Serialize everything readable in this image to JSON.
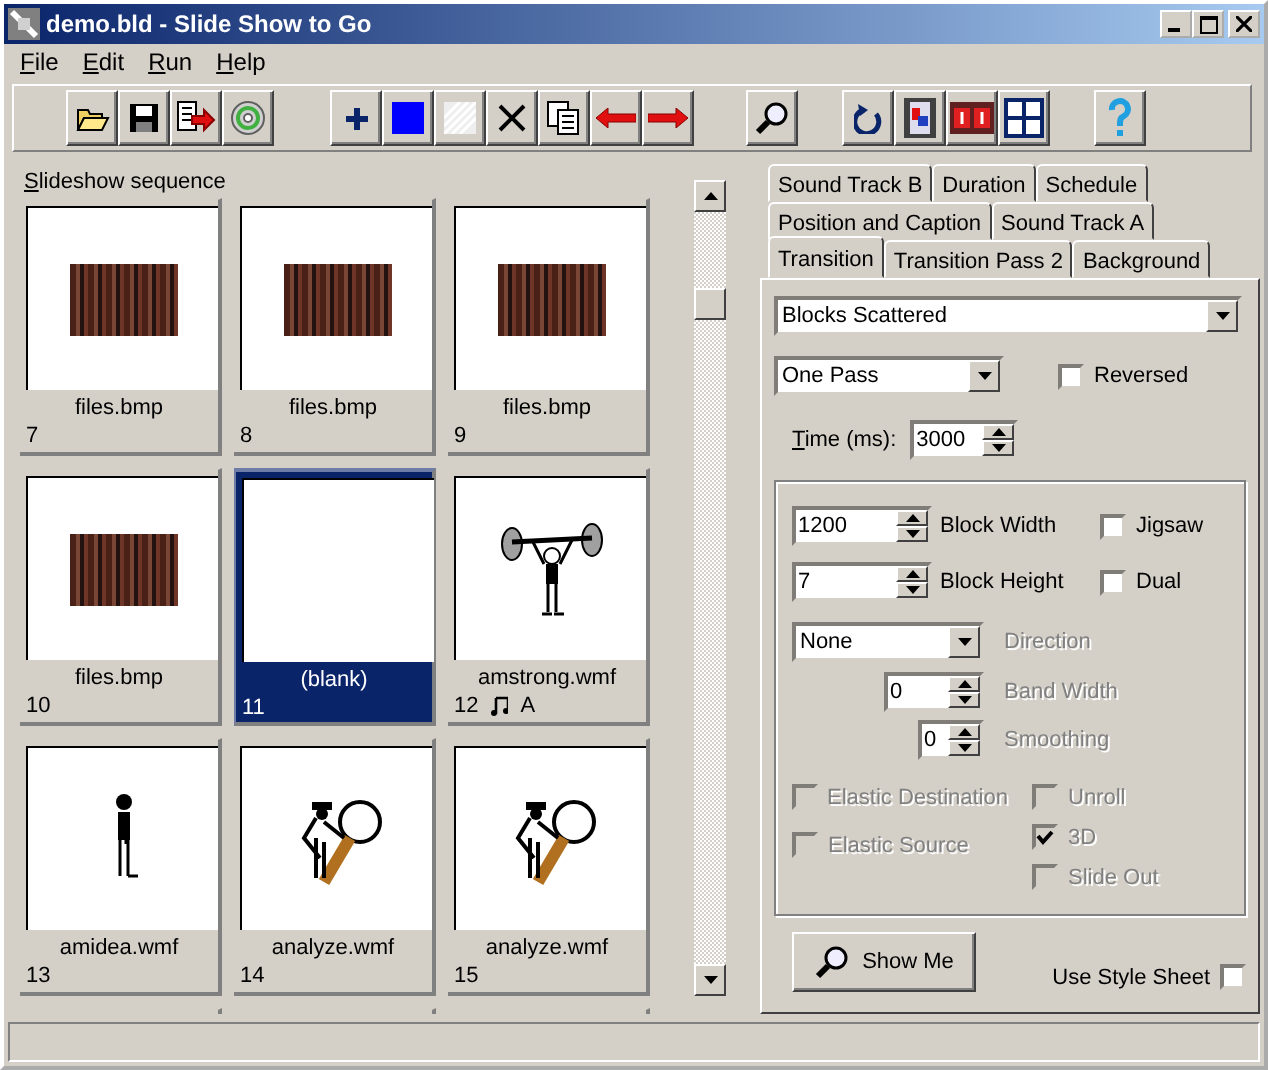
{
  "window": {
    "title": "demo.bld - Slide Show to Go"
  },
  "menu": [
    {
      "label": "File"
    },
    {
      "label": "Edit"
    },
    {
      "label": "Run"
    },
    {
      "label": "Help"
    }
  ],
  "sequence": {
    "label": "Slideshow sequence",
    "slides": [
      {
        "kind": "mosaic",
        "caption": "files.bmp",
        "number": "7",
        "selected": false
      },
      {
        "kind": "mosaic",
        "caption": "files.bmp",
        "number": "8",
        "selected": false
      },
      {
        "kind": "mosaic",
        "caption": "files.bmp",
        "number": "9",
        "selected": false
      },
      {
        "kind": "mosaic",
        "caption": "files.bmp",
        "number": "10",
        "selected": false
      },
      {
        "kind": "blank",
        "caption": "(blank)",
        "number": "11",
        "selected": true
      },
      {
        "kind": "weightlifter",
        "caption": "amstrong.wmf",
        "number": "12",
        "selected": false,
        "sound_track": "A"
      },
      {
        "kind": "standing",
        "caption": "amidea.wmf",
        "number": "13",
        "selected": false
      },
      {
        "kind": "magnifier",
        "caption": "analyze.wmf",
        "number": "14",
        "selected": false
      },
      {
        "kind": "magnifier",
        "caption": "analyze.wmf",
        "number": "15",
        "selected": false
      },
      {
        "kind": "clipped",
        "selected": false
      },
      {
        "kind": "clipped",
        "selected": false
      },
      {
        "kind": "clipped",
        "selected": false
      }
    ]
  },
  "tab_rows": [
    [
      {
        "label": "Sound Track B",
        "selected": false
      },
      {
        "label": "Duration",
        "selected": false
      },
      {
        "label": "Schedule",
        "selected": false
      }
    ],
    [
      {
        "label": "Position and Caption",
        "selected": false
      },
      {
        "label": "Sound Track A",
        "selected": false
      }
    ],
    [
      {
        "label": "Transition",
        "selected": true
      },
      {
        "label": "Transition Pass 2",
        "selected": false
      },
      {
        "label": "Background",
        "selected": false
      }
    ]
  ],
  "transition": {
    "effect": {
      "value": "Blocks Scattered"
    },
    "pass": {
      "value": "One Pass"
    },
    "reversed": {
      "label": "Reversed",
      "checked": false,
      "disabled": false
    },
    "time": {
      "label": "Time (ms):",
      "value": "3000"
    },
    "block_width": {
      "value": "1200",
      "label": "Block Width"
    },
    "jigsaw": {
      "label": "Jigsaw",
      "checked": false,
      "disabled": false
    },
    "block_height": {
      "value": "7",
      "label": "Block Height"
    },
    "dual": {
      "label": "Dual",
      "checked": false,
      "disabled": false
    },
    "direction": {
      "value": "None",
      "label": "Direction",
      "disabled": true
    },
    "band_width": {
      "value": "0",
      "label": "Band Width",
      "disabled": true
    },
    "smoothing": {
      "value": "0",
      "label": "Smoothing",
      "disabled": true
    },
    "left_options": [
      {
        "label": "Elastic Destination",
        "checked": false,
        "disabled": true
      },
      {
        "label": "Elastic Source",
        "checked": false,
        "disabled": true
      }
    ],
    "right_options": [
      {
        "label": "Unroll",
        "checked": false,
        "disabled": true
      },
      {
        "label": "3D",
        "checked": true,
        "disabled": true
      },
      {
        "label": "Slide Out",
        "checked": false,
        "disabled": true
      }
    ]
  },
  "show_me_button": {
    "label": "Show Me"
  },
  "use_style_sheet": {
    "label": "Use Style Sheet",
    "checked": false,
    "disabled": false
  }
}
